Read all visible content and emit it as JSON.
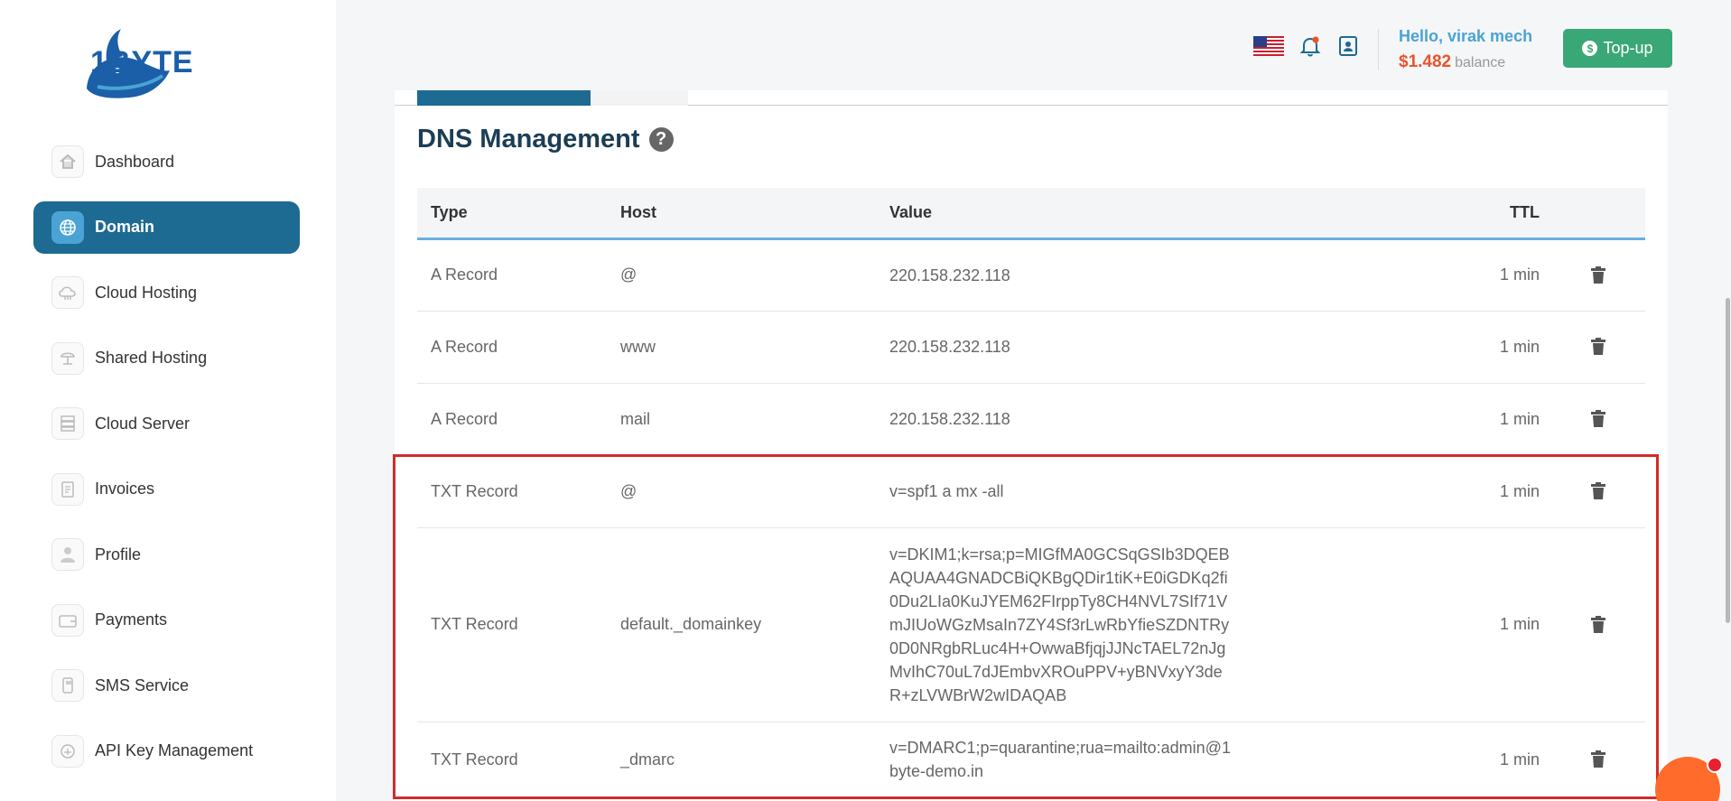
{
  "brand": {
    "name": "1BYTE"
  },
  "sidebar": {
    "items": [
      {
        "label": "Dashboard",
        "icon": "home-icon",
        "active": false
      },
      {
        "label": "Domain",
        "icon": "globe-icon",
        "active": true
      },
      {
        "label": "Cloud Hosting",
        "icon": "cloud-icon",
        "active": false
      },
      {
        "label": "Shared Hosting",
        "icon": "shared-hosting-icon",
        "active": false
      },
      {
        "label": "Cloud Server",
        "icon": "server-icon",
        "active": false
      },
      {
        "label": "Invoices",
        "icon": "invoice-icon",
        "active": false
      },
      {
        "label": "Profile",
        "icon": "user-icon",
        "active": false
      },
      {
        "label": "Payments",
        "icon": "wallet-icon",
        "active": false
      },
      {
        "label": "SMS Service",
        "icon": "sms-icon",
        "active": false
      },
      {
        "label": "API Key Management",
        "icon": "api-key-icon",
        "active": false
      }
    ]
  },
  "header": {
    "greeting": "Hello, virak mech",
    "balance": "$1.482",
    "balance_label": "balance",
    "topup_label": "Top-up"
  },
  "dns": {
    "title": "DNS Management",
    "columns": {
      "type": "Type",
      "host": "Host",
      "value": "Value",
      "ttl": "TTL"
    },
    "records": [
      {
        "type": "A Record",
        "host": "@",
        "value": "220.158.232.118",
        "ttl": "1 min"
      },
      {
        "type": "A Record",
        "host": "www",
        "value": "220.158.232.118",
        "ttl": "1 min"
      },
      {
        "type": "A Record",
        "host": "mail",
        "value": "220.158.232.118",
        "ttl": "1 min"
      },
      {
        "type": "TXT Record",
        "host": "@",
        "value": "v=spf1 a mx -all",
        "ttl": "1 min"
      },
      {
        "type": "TXT Record",
        "host": "default._domainkey",
        "value": "v=DKIM1;k=rsa;p=MIGfMA0GCSqGSIb3DQEBAQUAA4GNADCBiQKBgQDir1tiK+E0iGDKq2fi0Du2LIa0KuJYEM62FIrppTy8CH4NVL7SIf71VmJIUoWGzMsaIn7ZY4Sf3rLwRbYfieSZDNTRy0D0NRgbRLuc4H+OwwaBfjqjJJNcTAEL72nJgMvIhC70uL7dJEmbvXROuPPV+yBNVxyY3deR+zLVWBrW2wIDAQAB",
        "ttl": "1 min"
      },
      {
        "type": "TXT Record",
        "host": "_dmarc",
        "value": "v=DMARC1;p=quarantine;rua=mailto:admin@1byte-demo.in",
        "ttl": "1 min"
      }
    ]
  },
  "colors": {
    "primary": "#1d6a92",
    "accent": "#4aa3d4",
    "balance": "#e8552b",
    "topup": "#3aa776",
    "highlight": "#d42a2a"
  }
}
